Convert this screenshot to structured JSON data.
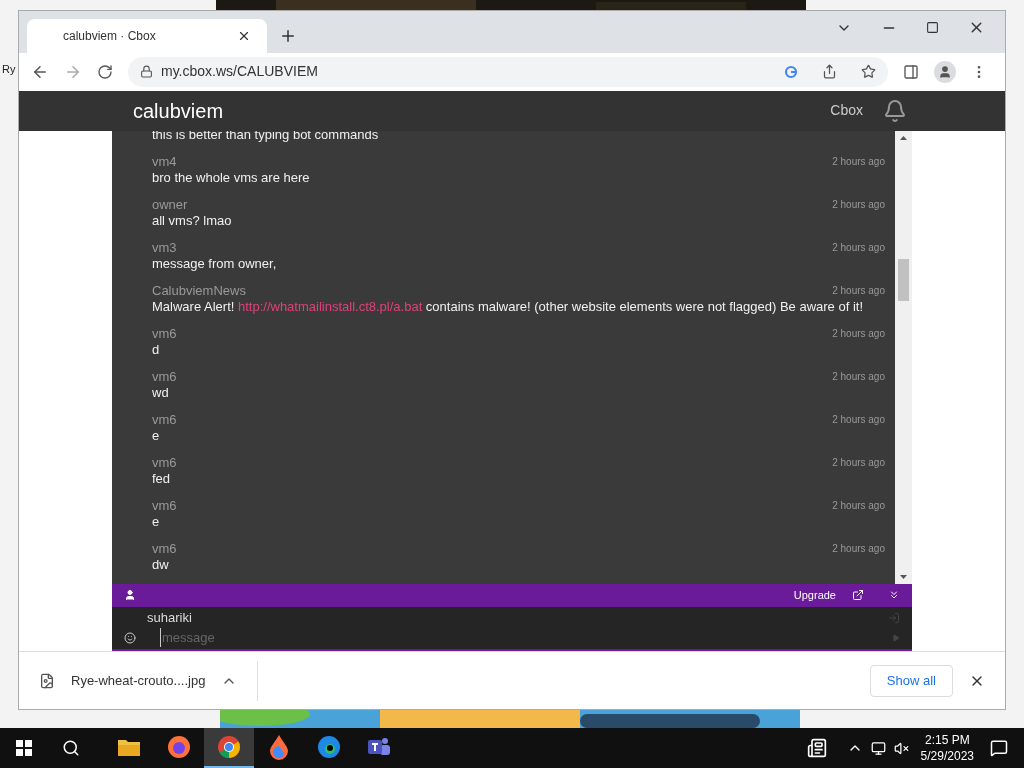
{
  "desktop": {
    "icon_label": "Ry"
  },
  "browser": {
    "tab": {
      "title": "calubviem · Cbox",
      "selected": true
    },
    "url": "my.cbox.ws/CALUBVIEM"
  },
  "page": {
    "header": {
      "title": "calubviem",
      "link": "Cbox"
    },
    "messages": [
      {
        "parts": [
          {
            "kind": "text",
            "text": "this is better than typing bot commands"
          }
        ]
      },
      {
        "author": "vm4",
        "time": "2 hours ago",
        "parts": [
          {
            "kind": "text",
            "text": "bro the whole vms are here"
          }
        ]
      },
      {
        "author": "owner",
        "time": "2 hours ago",
        "parts": [
          {
            "kind": "text",
            "text": "all vms? lmao"
          }
        ]
      },
      {
        "author": "vm3",
        "time": "2 hours ago",
        "parts": [
          {
            "kind": "text",
            "text": "message from owner,"
          }
        ]
      },
      {
        "author": "CalubviemNews",
        "time": "2 hours ago",
        "parts": [
          {
            "kind": "text",
            "text": "Malware Alert! "
          },
          {
            "kind": "link",
            "text": "http://whatmailinstall.ct8.pl/a.bat"
          },
          {
            "kind": "text",
            "text": " contains malware! (other website elements were not flagged) Be aware of it!"
          }
        ]
      },
      {
        "author": "vm6",
        "time": "2 hours ago",
        "parts": [
          {
            "kind": "text",
            "text": "d"
          }
        ]
      },
      {
        "author": "vm6",
        "time": "2 hours ago",
        "parts": [
          {
            "kind": "text",
            "text": "wd"
          }
        ]
      },
      {
        "author": "vm6",
        "time": "2 hours ago",
        "parts": [
          {
            "kind": "text",
            "text": "e"
          }
        ]
      },
      {
        "author": "vm6",
        "time": "2 hours ago",
        "parts": [
          {
            "kind": "text",
            "text": "fed"
          }
        ]
      },
      {
        "author": "vm6",
        "time": "2 hours ago",
        "parts": [
          {
            "kind": "text",
            "text": "e"
          }
        ]
      },
      {
        "author": "vm6",
        "time": "2 hours ago",
        "parts": [
          {
            "kind": "text",
            "text": "dw"
          }
        ]
      }
    ],
    "toolbar": {
      "upgrade": "Upgrade"
    },
    "composer": {
      "username": "suhariki",
      "placeholder": "message"
    }
  },
  "downloads": {
    "file": "Rye-wheat-crouto....jpg",
    "show_all": "Show all"
  },
  "taskbar": {
    "time": "2:15 PM",
    "date": "5/29/2023",
    "apps": [
      {
        "kind": "files",
        "selected": false
      },
      {
        "kind": "firefox",
        "selected": false
      },
      {
        "kind": "chrome",
        "selected": true
      },
      {
        "kind": "drop",
        "selected": false
      },
      {
        "kind": "edge",
        "selected": false
      },
      {
        "kind": "teams",
        "selected": false
      }
    ]
  }
}
